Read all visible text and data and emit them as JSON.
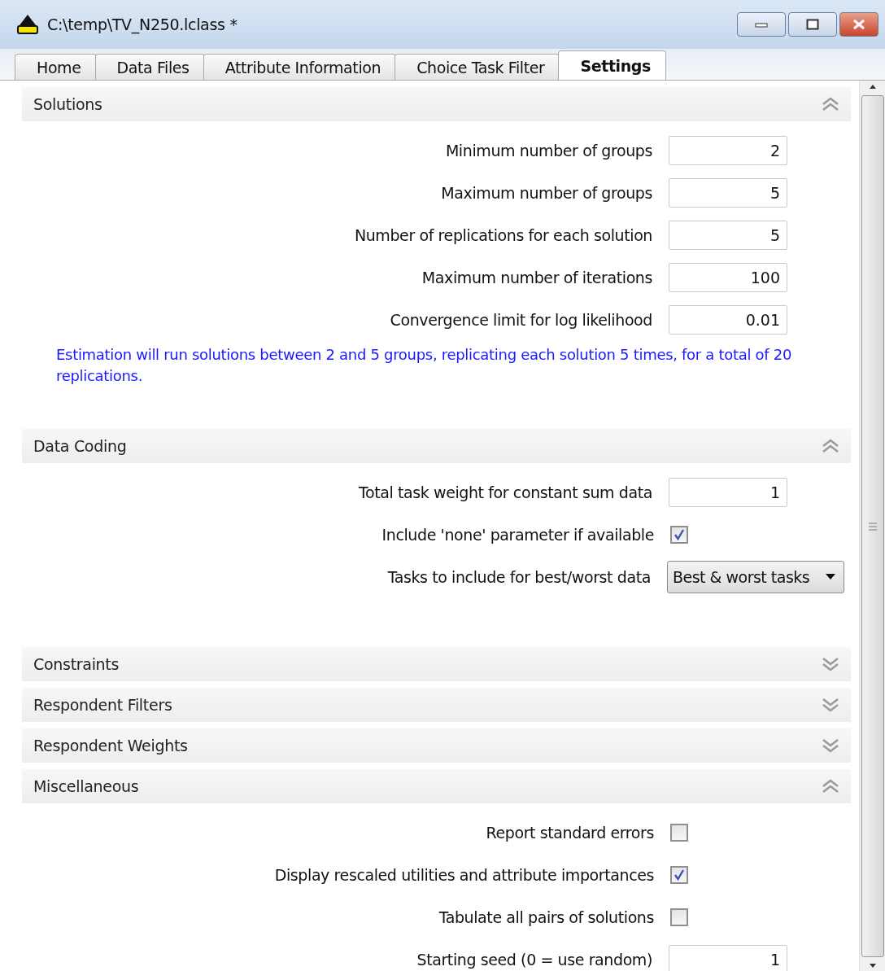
{
  "window": {
    "title": "C:\\temp\\TV_N250.lclass *"
  },
  "tabs": [
    {
      "label": "Home",
      "selected": false
    },
    {
      "label": "Data Files",
      "selected": false
    },
    {
      "label": "Attribute Information",
      "selected": false
    },
    {
      "label": "Choice Task Filter",
      "selected": false
    },
    {
      "label": "Settings",
      "selected": true
    }
  ],
  "sections": [
    {
      "title": "Solutions",
      "expanded": true,
      "rows": [
        {
          "kind": "field",
          "label": "Minimum number of groups",
          "value": "2"
        },
        {
          "kind": "field",
          "label": "Maximum number of groups",
          "value": "5"
        },
        {
          "kind": "field",
          "label": "Number of replications for each solution",
          "value": "5"
        },
        {
          "kind": "field",
          "label": "Maximum number of iterations",
          "value": "100"
        },
        {
          "kind": "field",
          "label": "Convergence limit for log likelihood",
          "value": "0.01"
        }
      ],
      "note": "Estimation will run solutions between 2 and 5 groups, replicating each solution 5 times, for a total of 20 replications."
    },
    {
      "title": "Data Coding",
      "expanded": true,
      "rows": [
        {
          "kind": "field",
          "label": "Total task weight for constant sum data",
          "value": "1"
        },
        {
          "kind": "checkbox",
          "label": "Include 'none' parameter if available",
          "checked": true
        },
        {
          "kind": "dropdown",
          "label": "Tasks to include for best/worst data",
          "value": "Best & worst tasks"
        }
      ]
    },
    {
      "title": "Constraints",
      "expanded": false
    },
    {
      "title": "Respondent Filters",
      "expanded": false
    },
    {
      "title": "Respondent Weights",
      "expanded": false
    },
    {
      "title": "Miscellaneous",
      "expanded": true,
      "rows": [
        {
          "kind": "checkbox",
          "label": "Report standard errors",
          "checked": false
        },
        {
          "kind": "checkbox",
          "label": "Display rescaled utilities and attribute importances",
          "checked": true
        },
        {
          "kind": "checkbox",
          "label": "Tabulate all pairs of solutions",
          "checked": false
        },
        {
          "kind": "field",
          "label": "Starting seed (0 = use random)",
          "value": "1"
        }
      ]
    }
  ]
}
